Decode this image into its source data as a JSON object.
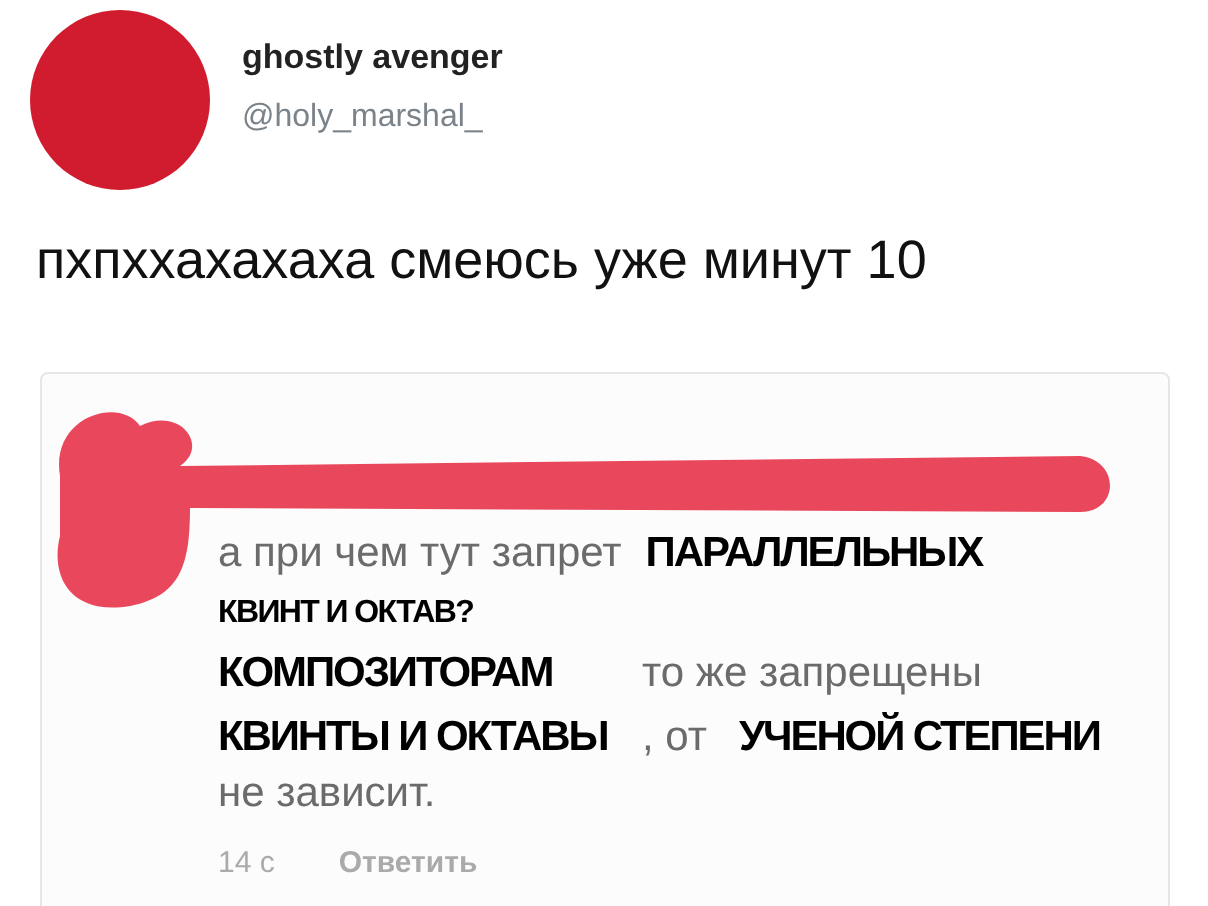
{
  "author": {
    "name": "ghostly avenger",
    "handle": "@holy_marshal_"
  },
  "tweet_text": "пхпххахахаха смеюсь уже минут 10",
  "comment": {
    "lines": [
      {
        "kind": "flow",
        "segments": [
          {
            "text": "а при чем тут запрет",
            "kind": "original"
          },
          {
            "text": "ПАРАЛЛЕЛЬНЫХ",
            "kind": "overlay"
          }
        ]
      },
      {
        "kind": "flow",
        "segments": [
          {
            "text": "КВИНТ И ОКТАВ?",
            "kind": "overlay_small"
          }
        ]
      },
      {
        "kind": "columns",
        "segments": [
          {
            "text": "КОМПОЗИТОРАМ",
            "kind": "overlay"
          },
          {
            "text": "то же запрещены",
            "kind": "original"
          }
        ]
      },
      {
        "kind": "columns",
        "segments": [
          {
            "text": "КВИНТЫ И ОКТАВЫ",
            "kind": "overlay"
          },
          {
            "text": ", от",
            "kind": "original"
          },
          {
            "text": "УЧЕНОЙ СТЕПЕНИ",
            "kind": "overlay"
          }
        ]
      },
      {
        "kind": "flow",
        "segments": [
          {
            "text": "не зависит.",
            "kind": "original"
          }
        ]
      }
    ],
    "time": "14 с",
    "reply": "Ответить"
  }
}
